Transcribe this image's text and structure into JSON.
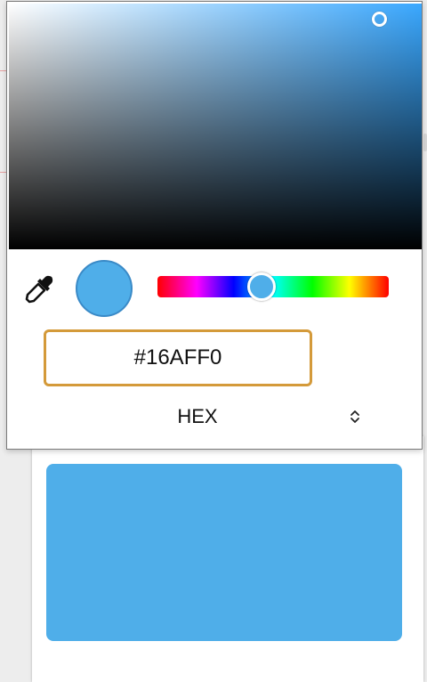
{
  "colors": {
    "selected": "#4faee9",
    "hue": "#3aa8ff",
    "input_border": "#d49a3a"
  },
  "picker": {
    "eyedropper_icon": "eyedropper-icon",
    "hue_percent": 45,
    "hex_value": "#16AFF0",
    "format_label": "HEX",
    "format_icon": "chevron-up-down-icon"
  }
}
